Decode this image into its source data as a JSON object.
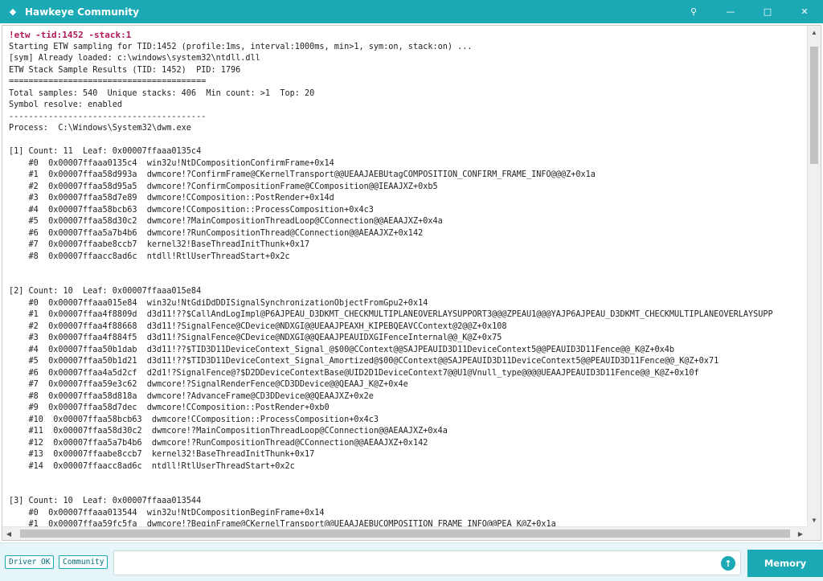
{
  "window": {
    "title": "Hawkeye Community",
    "app_icon": "diamond-icon",
    "controls": {
      "pin": "⚲",
      "minimize": "—",
      "maximize": "□",
      "close": "✕"
    }
  },
  "console": {
    "lines": [
      "!etw -tid:1452 -stack:1",
      "Starting ETW sampling for TID:1452 (profile:1ms, interval:1000ms, min>1, sym:on, stack:on) ...",
      "[sym] Already loaded: c:\\windows\\system32\\ntdll.dll",
      "ETW Stack Sample Results (TID: 1452)  PID: 1796",
      "========================================",
      "Total samples: 540  Unique stacks: 406  Min count: >1  Top: 20",
      "Symbol resolve: enabled",
      "----------------------------------------",
      "Process:  C:\\Windows\\System32\\dwm.exe",
      "",
      "[1] Count: 11  Leaf: 0x00007ffaaa0135c4",
      "    #0  0x00007ffaaa0135c4  win32u!NtDCompositionConfirmFrame+0x14",
      "    #1  0x00007ffaa58d993a  dwmcore!?ConfirmFrame@CKernelTransport@@UEAAJAEBUtagCOMPOSITION_CONFIRM_FRAME_INFO@@@Z+0x1a",
      "    #2  0x00007ffaa58d95a5  dwmcore!?ConfirmCompositionFrame@CComposition@@IEAAJXZ+0xb5",
      "    #3  0x00007ffaa58d7e89  dwmcore!CComposition::PostRender+0x14d",
      "    #4  0x00007ffaa58bcb63  dwmcore!CComposition::ProcessComposition+0x4c3",
      "    #5  0x00007ffaa58d30c2  dwmcore!?MainCompositionThreadLoop@CConnection@@AEAAJXZ+0x4a",
      "    #6  0x00007ffaa5a7b4b6  dwmcore!?RunCompositionThread@CConnection@@AEAAJXZ+0x142",
      "    #7  0x00007ffaabe8ccb7  kernel32!BaseThreadInitThunk+0x17",
      "    #8  0x00007ffaacc8ad6c  ntdll!RtlUserThreadStart+0x2c",
      "",
      "",
      "[2] Count: 10  Leaf: 0x00007ffaaa015e84",
      "    #0  0x00007ffaaa015e84  win32u!NtGdiDdDDISignalSynchronizationObjectFromGpu2+0x14",
      "    #1  0x00007ffaa4f8809d  d3d11!??$CallAndLogImpl@P6AJPEAU_D3DKMT_CHECKMULTIPLANEOVERLAYSUPPORT3@@@ZPEAU1@@@YAJP6AJPEAU_D3DKMT_CHECKMULTIPLANEOVERLAYSUPP",
      "    #2  0x00007ffaa4f88668  d3d11!?SignalFence@CDevice@NDXGI@@UEAAJPEAXH_KIPEBQEAVCContext@2@@Z+0x108",
      "    #3  0x00007ffaa4f884f5  d3d11!?SignalFence@CDevice@NDXGI@@QEAAJPEAUIDXGIFenceInternal@@_K@Z+0x75",
      "    #4  0x00007ffaa50b1dab  d3d11!??$TID3D11DeviceContext_Signal_@$00@CContext@@SAJPEAUID3D11DeviceContext5@@PEAUID3D11Fence@@_K@Z+0x4b",
      "    #5  0x00007ffaa50b1d21  d3d11!??$TID3D11DeviceContext_Signal_Amortized@$00@CContext@@SAJPEAUID3D11DeviceContext5@@PEAUID3D11Fence@@_K@Z+0x71",
      "    #6  0x00007ffaa4a5d2cf  d2d1!?SignalFence@?$D2DDeviceContextBase@UID2D1DeviceContext7@@U1@Vnull_type@@@@UEAAJPEAUID3D11Fence@@_K@Z+0x10f",
      "    #7  0x00007ffaa59e3c62  dwmcore!?SignalRenderFence@CD3DDevice@@QEAAJ_K@Z+0x4e",
      "    #8  0x00007ffaa58d818a  dwmcore!?AdvanceFrame@CD3DDevice@@QEAAJXZ+0x2e",
      "    #9  0x00007ffaa58d7dec  dwmcore!CComposition::PostRender+0xb0",
      "    #10  0x00007ffaa58bcb63  dwmcore!CComposition::ProcessComposition+0x4c3",
      "    #11  0x00007ffaa58d30c2  dwmcore!?MainCompositionThreadLoop@CConnection@@AEAAJXZ+0x4a",
      "    #12  0x00007ffaa5a7b4b6  dwmcore!?RunCompositionThread@CConnection@@AEAAJXZ+0x142",
      "    #13  0x00007ffaabe8ccb7  kernel32!BaseThreadInitThunk+0x17",
      "    #14  0x00007ffaacc8ad6c  ntdll!RtlUserThreadStart+0x2c",
      "",
      "",
      "[3] Count: 10  Leaf: 0x00007ffaaa013544",
      "    #0  0x00007ffaaa013544  win32u!NtDCompositionBeginFrame+0x14",
      "    #1  0x00007ffaa59fc5fa  dwmcore!?BeginFrame@CKernelTransport@@UEAAJAEBUCOMPOSITION_FRAME_INFO@@PEA_K@Z+0x1a"
    ]
  },
  "footer": {
    "status_badge": "Driver OK",
    "community_badge": "Community",
    "command_input_value": "",
    "command_input_placeholder": "",
    "send_icon": "arrow-up-icon",
    "memory_button": "Memory"
  }
}
